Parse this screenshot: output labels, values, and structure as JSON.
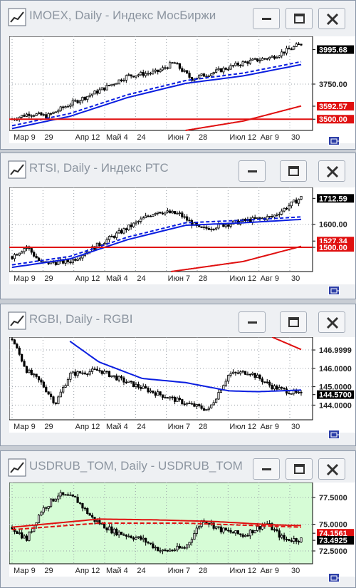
{
  "windows": [
    {
      "title": "IMOEX, Daily - Индекс МосБиржи",
      "chart_bg": "#ffffff",
      "price_labels": [
        {
          "text": "3995.68",
          "value": 3995.68,
          "style": "current"
        },
        {
          "text": "3750.00",
          "value": 3750.0,
          "style": "grid"
        },
        {
          "text": "3592.57",
          "value": 3592.57,
          "style": "red"
        },
        {
          "text": "3500.00",
          "value": 3500.0,
          "style": "red"
        }
      ],
      "date_labels": [
        "Мар 9",
        "29",
        "Апр 12",
        "Май 4",
        "24",
        "Июн 7",
        "28",
        "Июл 12",
        "Авг 9",
        "30"
      ],
      "hline": 3500.0,
      "y_range": [
        3420,
        4090
      ]
    },
    {
      "title": "RTSI, Daily - Индекс РТС",
      "chart_bg": "#ffffff",
      "price_labels": [
        {
          "text": "1712.59",
          "value": 1712.59,
          "style": "current"
        },
        {
          "text": "1600.00",
          "value": 1600.0,
          "style": "grid"
        },
        {
          "text": "1527.34",
          "value": 1527.34,
          "style": "red"
        },
        {
          "text": "1500.00",
          "value": 1500.0,
          "style": "red"
        }
      ],
      "date_labels": [
        "Мар 9",
        "29",
        "Апр 12",
        "Май 4",
        "24",
        "Июн 7",
        "28",
        "Июл 12",
        "Авг 9",
        "30"
      ],
      "hline": 1500.0,
      "y_range": [
        1395,
        1760
      ]
    },
    {
      "title": "RGBI, Daily - RGBI",
      "chart_bg": "#ffffff",
      "price_labels": [
        {
          "text": "146.9999",
          "value": 146.9999,
          "style": "grid"
        },
        {
          "text": "146.0000",
          "value": 146.0,
          "style": "grid"
        },
        {
          "text": "145.0000",
          "value": 145.0,
          "style": "grid"
        },
        {
          "text": "144.5700",
          "value": 144.57,
          "style": "current"
        },
        {
          "text": "144.0000",
          "value": 144.0,
          "style": "grid"
        }
      ],
      "date_labels": [
        "Мар 9",
        "29",
        "Апр 12",
        "Май 4",
        "24",
        "Июн 7",
        "28",
        "Июл 12",
        "Авг 9",
        "30"
      ],
      "hline": null,
      "y_range": [
        143.2,
        147.7
      ]
    },
    {
      "title": "USDRUB_TOM, Daily - USDRUB_TOM",
      "chart_bg": "#d6fcd6",
      "price_labels": [
        {
          "text": "77.5000",
          "value": 77.5,
          "style": "grid"
        },
        {
          "text": "75.0000",
          "value": 75.0,
          "style": "grid"
        },
        {
          "text": "74.1561",
          "value": 74.1561,
          "style": "red"
        },
        {
          "text": "73.4925",
          "value": 73.4925,
          "style": "current"
        },
        {
          "text": "72.5000",
          "value": 72.5,
          "style": "grid"
        }
      ],
      "date_labels": [
        "Мар 9",
        "29",
        "Апр 12",
        "Май 4",
        "24",
        "Июн 7",
        "28",
        "Июл 12",
        "Авг 9",
        "30"
      ],
      "hline": null,
      "y_range": [
        71.3,
        78.9
      ]
    }
  ],
  "colors": {
    "candle": "#000000",
    "ma_blue": "#0a1ee0",
    "ma_red": "#e01010",
    "grid": "#9aa0a8",
    "current_label_bg": "#000000",
    "red_label_bg": "#e01010"
  }
}
